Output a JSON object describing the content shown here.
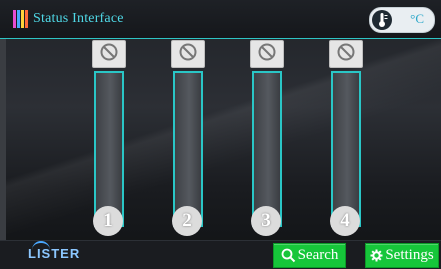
{
  "header": {
    "title": "Status Interface",
    "temp_unit": "°C"
  },
  "channels": [
    {
      "number": "1",
      "status_icon": "disabled-icon"
    },
    {
      "number": "2",
      "status_icon": "disabled-icon"
    },
    {
      "number": "3",
      "status_icon": "disabled-icon"
    },
    {
      "number": "4",
      "status_icon": "disabled-icon"
    }
  ],
  "footer": {
    "logo": "LISTER",
    "search_label": "Search",
    "settings_label": "Settings"
  },
  "colors": {
    "accent": "#2ec4c4",
    "title": "#4fd8e6",
    "button": "#16c63a"
  }
}
